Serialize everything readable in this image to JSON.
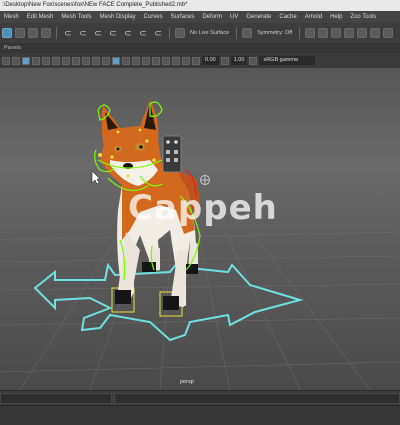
{
  "window": {
    "title": ":\\Desktop\\New Fox\\scenes\\fox\\NEw FACE Complete_Published2.mb*"
  },
  "menubar": {
    "items": [
      "Mesh",
      "Edit Mesh",
      "Mesh Tools",
      "Mesh Display",
      "Curves",
      "Surfaces",
      "Deform",
      "UV",
      "Generate",
      "Cache",
      "Arnold",
      "Help",
      "Zoo Tools"
    ]
  },
  "shelf": {
    "live_surface": "No Live Surface",
    "symmetry": "Symmetry: Off"
  },
  "panel": {
    "menus": [
      "Panels"
    ]
  },
  "viewbar": {
    "field1": "0.00",
    "field2": "1.00",
    "colorspace": "sRGB gamma"
  },
  "viewport": {
    "camera": "persp",
    "watermark": "Cappeh"
  },
  "colors": {
    "background_top": "#575757",
    "background_bottom": "#4a4a4a",
    "fox_orange": "#d2691e",
    "control_green": "#7cfc00",
    "control_cyan": "#6fe0e0",
    "control_yellow": "#e8e040"
  }
}
